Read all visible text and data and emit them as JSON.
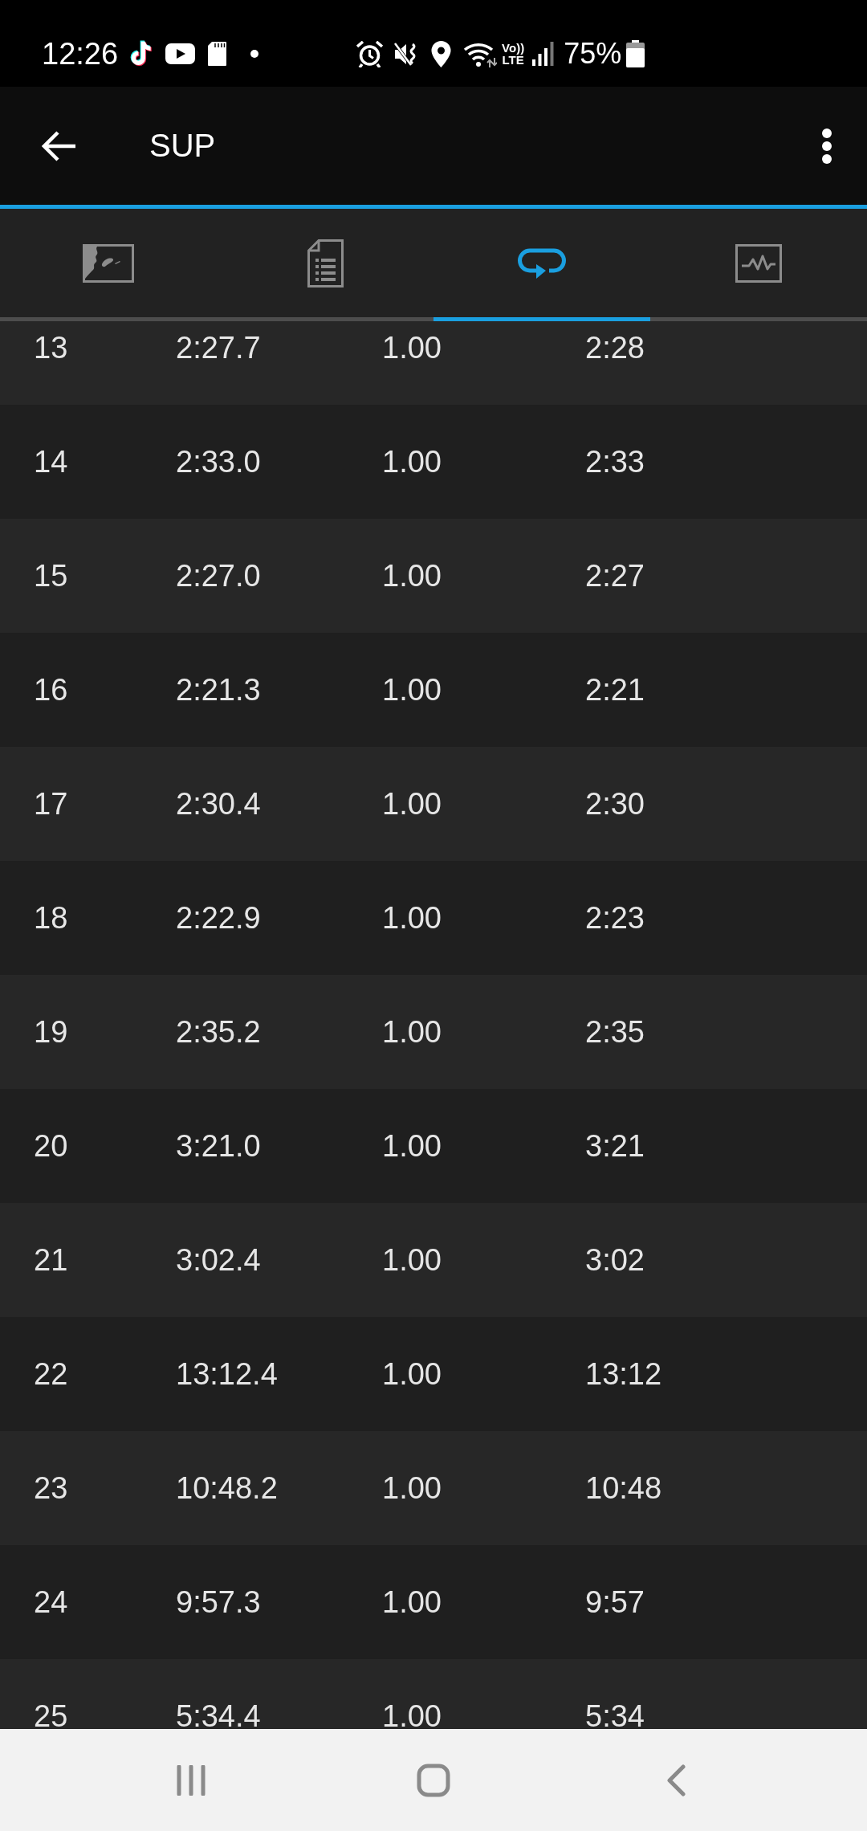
{
  "status_bar": {
    "time": "12:26",
    "volte": [
      "Vo))",
      "LTE"
    ],
    "battery": "75%"
  },
  "app_bar": {
    "title": "SUP"
  },
  "tabs": [
    {
      "kind": "map",
      "selected": false
    },
    {
      "kind": "summary",
      "selected": false
    },
    {
      "kind": "laps",
      "selected": true
    },
    {
      "kind": "chart",
      "selected": false
    }
  ],
  "table": {
    "rows": [
      [
        "13",
        "2:27.7",
        "1.00",
        "2:28"
      ],
      [
        "14",
        "2:33.0",
        "1.00",
        "2:33"
      ],
      [
        "15",
        "2:27.0",
        "1.00",
        "2:27"
      ],
      [
        "16",
        "2:21.3",
        "1.00",
        "2:21"
      ],
      [
        "17",
        "2:30.4",
        "1.00",
        "2:30"
      ],
      [
        "18",
        "2:22.9",
        "1.00",
        "2:23"
      ],
      [
        "19",
        "2:35.2",
        "1.00",
        "2:35"
      ],
      [
        "20",
        "3:21.0",
        "1.00",
        "3:21"
      ],
      [
        "21",
        "3:02.4",
        "1.00",
        "3:02"
      ],
      [
        "22",
        "13:12.4",
        "1.00",
        "13:12"
      ],
      [
        "23",
        "10:48.2",
        "1.00",
        "10:48"
      ],
      [
        "24",
        "9:57.3",
        "1.00",
        "9:57"
      ],
      [
        "25",
        "5:34.4",
        "1.00",
        "5:34"
      ]
    ]
  }
}
